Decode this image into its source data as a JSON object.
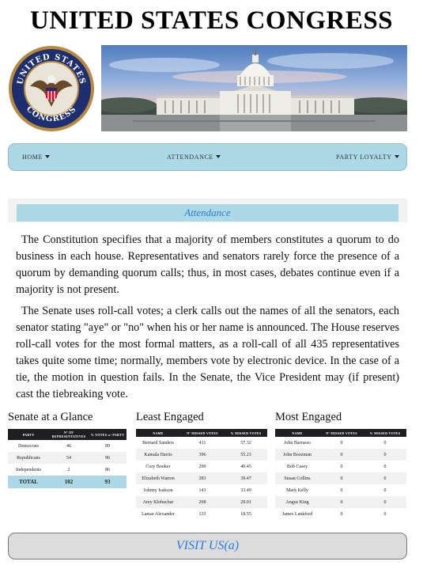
{
  "header": {
    "title": "UNITED STATES CONGRESS"
  },
  "seal": {
    "top_text": "UNITED STATES",
    "bottom_text": "CONGRESS"
  },
  "nav": {
    "items": [
      {
        "label": "HOME"
      },
      {
        "label": "ATTENDANCE"
      },
      {
        "label": "PARTY LOYALTY"
      }
    ]
  },
  "attendance": {
    "heading": "Attendance",
    "paragraph1": "The Constitution specifies that a majority of members constitutes a quorum to do business in each house. Representatives and senators rarely force the presence of a quorum by demanding quorum calls; thus, in most cases, debates continue even if a majority is not present.",
    "paragraph2": "The Senate uses roll-call votes; a clerk calls out the names of all the senators, each senator stating \"aye\" or \"no\" when his or her name is announced. The House reserves roll-call votes for the most formal matters, as a roll-call of all 435 representatives takes quite some time; normally, members vote by electronic device. In the case of a tie, the motion in question fails. In the Senate, the Vice President may (if present) cast the tiebreaking vote."
  },
  "glance": {
    "title": "Senate at a Glance",
    "headers": [
      "PARTY",
      "Nº OF REPRESENTATIVES",
      "% VOTES w/ PARTY"
    ],
    "rows": [
      [
        "Democrats",
        "46",
        "89"
      ],
      [
        "Republicans",
        "54",
        "96"
      ],
      [
        "Independents",
        "2",
        "86"
      ]
    ],
    "total": [
      "TOTAL",
      "102",
      "93"
    ]
  },
  "least": {
    "title": "Least Engaged",
    "headers": [
      "NAME",
      "Nº MISSED VOTES",
      "% MISSED VOTES"
    ],
    "rows": [
      [
        "Bernard Sanders",
        "411",
        "57.32"
      ],
      [
        "Kamala Harris",
        "396",
        "55.23"
      ],
      [
        "Cory Booker",
        "290",
        "40.45"
      ],
      [
        "Elizabeth Warren",
        "283",
        "39.47"
      ],
      [
        "Johnny Isakson",
        "143",
        "33.49"
      ],
      [
        "Amy Klobuchar",
        "208",
        "29.01"
      ],
      [
        "Lamar Alexander",
        "133",
        "18.55"
      ]
    ]
  },
  "most": {
    "title": "Most Engaged",
    "headers": [
      "NAME",
      "Nº MISSED VOTES",
      "% MISSED VOTES"
    ],
    "rows": [
      [
        "John Barrasso",
        "0",
        "0"
      ],
      [
        "John Boozman",
        "0",
        "0"
      ],
      [
        "Bob Casey",
        "0",
        "0"
      ],
      [
        "Susan Collins",
        "0",
        "0"
      ],
      [
        "Mark Kelly",
        "0",
        "0"
      ],
      [
        "Angus King",
        "0",
        "0"
      ],
      [
        "James Lankford",
        "0",
        "0"
      ]
    ]
  },
  "footer": {
    "visit_label": "VISIT US(a)"
  }
}
